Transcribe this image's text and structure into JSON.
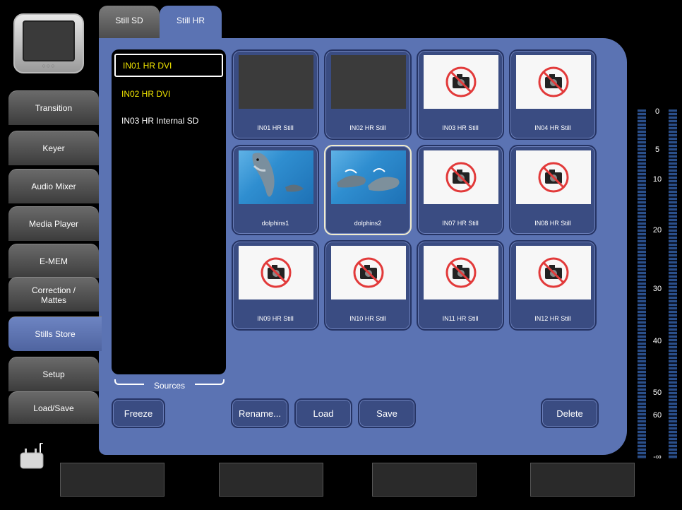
{
  "top_tabs": [
    {
      "label": "Still SD",
      "active": false
    },
    {
      "label": "Still HR",
      "active": true
    }
  ],
  "nav": [
    {
      "label": "Transition"
    },
    {
      "label": "Keyer"
    },
    {
      "label": "Audio Mixer"
    },
    {
      "label": "Media Player"
    },
    {
      "label": "E-MEM"
    },
    {
      "label": "Correction / Mattes"
    },
    {
      "label": "Stills Store",
      "active": true
    },
    {
      "label": "Setup"
    },
    {
      "label": "Load/Save"
    }
  ],
  "sources": {
    "label": "Sources",
    "items": [
      {
        "label": "IN01 HR DVI",
        "color": "#f2e600",
        "selected": true
      },
      {
        "label": "IN02 HR DVI",
        "color": "#f2e600",
        "selected": false
      },
      {
        "label": "IN03 HR Internal SD",
        "color": "#ffffff",
        "selected": false
      }
    ]
  },
  "stills": [
    {
      "label": "IN01 HR Still",
      "image": "empty"
    },
    {
      "label": "IN02 HR Still",
      "image": "empty"
    },
    {
      "label": "IN03 HR Still",
      "image": "no-photo-icon"
    },
    {
      "label": "IN04 HR Still",
      "image": "no-photo-icon"
    },
    {
      "label": "dolphins1",
      "image": "dolphin-photo"
    },
    {
      "label": "dolphins2",
      "image": "dolphins-photo",
      "selected": true
    },
    {
      "label": "IN07 HR Still",
      "image": "no-photo-icon"
    },
    {
      "label": "IN08 HR Still",
      "image": "no-photo-icon"
    },
    {
      "label": "IN09 HR Still",
      "image": "no-photo-icon"
    },
    {
      "label": "IN10 HR Still",
      "image": "no-photo-icon"
    },
    {
      "label": "IN11 HR Still",
      "image": "no-photo-icon"
    },
    {
      "label": "IN12 HR Still",
      "image": "no-photo-icon"
    }
  ],
  "buttons": {
    "freeze": "Freeze",
    "rename": "Rename...",
    "load": "Load",
    "save": "Save",
    "delete": "Delete"
  },
  "meter": {
    "labels": [
      "0",
      "5",
      "10",
      "20",
      "30",
      "40",
      "50",
      "60",
      "-∞"
    ]
  },
  "colors": {
    "panel": "#5b73b3",
    "tile": "#3a4c82",
    "source_yellow": "#f2e600",
    "selection": "#f1eccd"
  }
}
